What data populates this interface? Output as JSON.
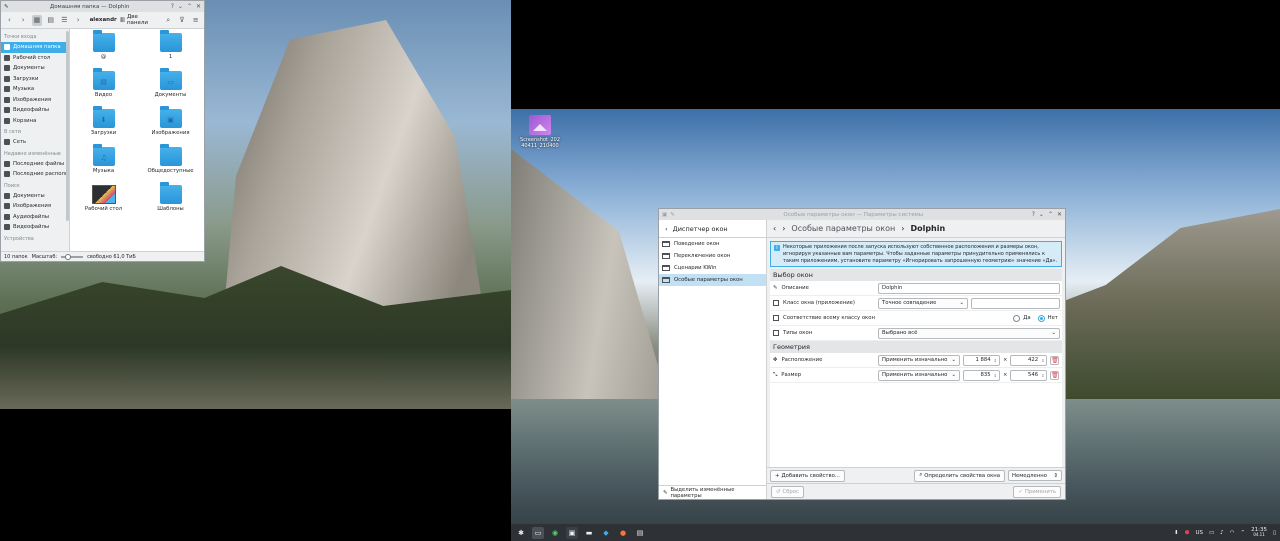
{
  "dolphin": {
    "title": "Домашняя папка — Dolphin",
    "breadcrumb": "alexandr",
    "split_label": "Две панели",
    "places": {
      "sections": [
        {
          "header": "Точки входа",
          "items": [
            {
              "label": "Домашняя папка",
              "selected": true
            },
            {
              "label": "Рабочий стол"
            },
            {
              "label": "Документы"
            },
            {
              "label": "Загрузки"
            },
            {
              "label": "Музыка"
            },
            {
              "label": "Изображения"
            },
            {
              "label": "Видеофайлы"
            },
            {
              "label": "Корзина"
            }
          ]
        },
        {
          "header": "В сети",
          "items": [
            {
              "label": "Сеть"
            }
          ]
        },
        {
          "header": "Недавно изменённые",
          "items": [
            {
              "label": "Последние файлы"
            },
            {
              "label": "Последние располо"
            }
          ]
        },
        {
          "header": "Поиск",
          "items": [
            {
              "label": "Документы"
            },
            {
              "label": "Изображения"
            },
            {
              "label": "Аудиофайлы"
            },
            {
              "label": "Видеофайлы"
            }
          ]
        },
        {
          "header": "Устройства",
          "items": []
        }
      ]
    },
    "files": [
      {
        "name": "@",
        "kind": "folder",
        "glyph": ""
      },
      {
        "name": "1",
        "kind": "folder",
        "glyph": ""
      },
      {
        "name": "Видео",
        "kind": "folder",
        "glyph": "▤"
      },
      {
        "name": "Документы",
        "kind": "folder",
        "glyph": "▭"
      },
      {
        "name": "Загрузки",
        "kind": "folder",
        "glyph": "⬇"
      },
      {
        "name": "Изображения",
        "kind": "folder",
        "glyph": "▣"
      },
      {
        "name": "Музыка",
        "kind": "folder",
        "glyph": "♫"
      },
      {
        "name": "Общедоступные",
        "kind": "folder",
        "glyph": ""
      },
      {
        "name": "Рабочий стол",
        "kind": "thumbnail",
        "glyph": ""
      },
      {
        "name": "Шаблоны",
        "kind": "folder",
        "glyph": ""
      }
    ],
    "status": {
      "count": "10 папок",
      "zoom_label": "Масштаб:",
      "free": "свободно 61,0 ТиБ"
    }
  },
  "desktop_icon": {
    "label": "Screenshot_202 40411_210400"
  },
  "settings": {
    "title": "Особые параметры окон — Параметры системы",
    "sidebar_title": "Диспетчер окон",
    "nav": [
      {
        "label": "Поведение окон"
      },
      {
        "label": "Переключение окон"
      },
      {
        "label": "Сценарии KWin"
      },
      {
        "label": "Особые параметры окон",
        "selected": true
      }
    ],
    "sidebar_footer": "Выделить изменённые параметры",
    "breadcrumb_parent": "Особые параметры окон",
    "breadcrumb_current": "Dolphin",
    "info": "Некоторые приложения после запуска используют собственное расположения и размеры окон, игнорируя указанные вам параметры. Чтобы заданные параметры принудительно применялись к таким приложениям, установите параметру «Игнорировать запрошенную геометрию» значение «Да».",
    "group_window": "Выбор окон",
    "description_label": "Описание",
    "description_value": "Dolphin",
    "class_label": "Класс окна (приложение)",
    "class_match": "Точное совпадение",
    "class_value": "",
    "whole_class_label": "Соответствие всему классу окон",
    "radio_yes": "Да",
    "radio_no": "Нет",
    "types_label": "Типы окон",
    "types_value": "Выбрано всё",
    "group_geometry": "Геометрия",
    "position_label": "Расположение",
    "position_rule": "Применить изначально",
    "position_x": "1 884",
    "position_y": "422",
    "size_label": "Размер",
    "size_rule": "Применить изначально",
    "size_w": "835",
    "size_h": "546",
    "times": "×",
    "add_property": "Добавить свойство...",
    "detect_props": "Определить свойства окна",
    "detect_delay": "Немедленно",
    "reset": "Сброс",
    "apply": "Применить"
  },
  "taskbar": {
    "layout": "US",
    "time": "21:35",
    "date": "04.11"
  },
  "colors": {
    "accent": "#3daee9",
    "taskbar": "#2e3136"
  }
}
